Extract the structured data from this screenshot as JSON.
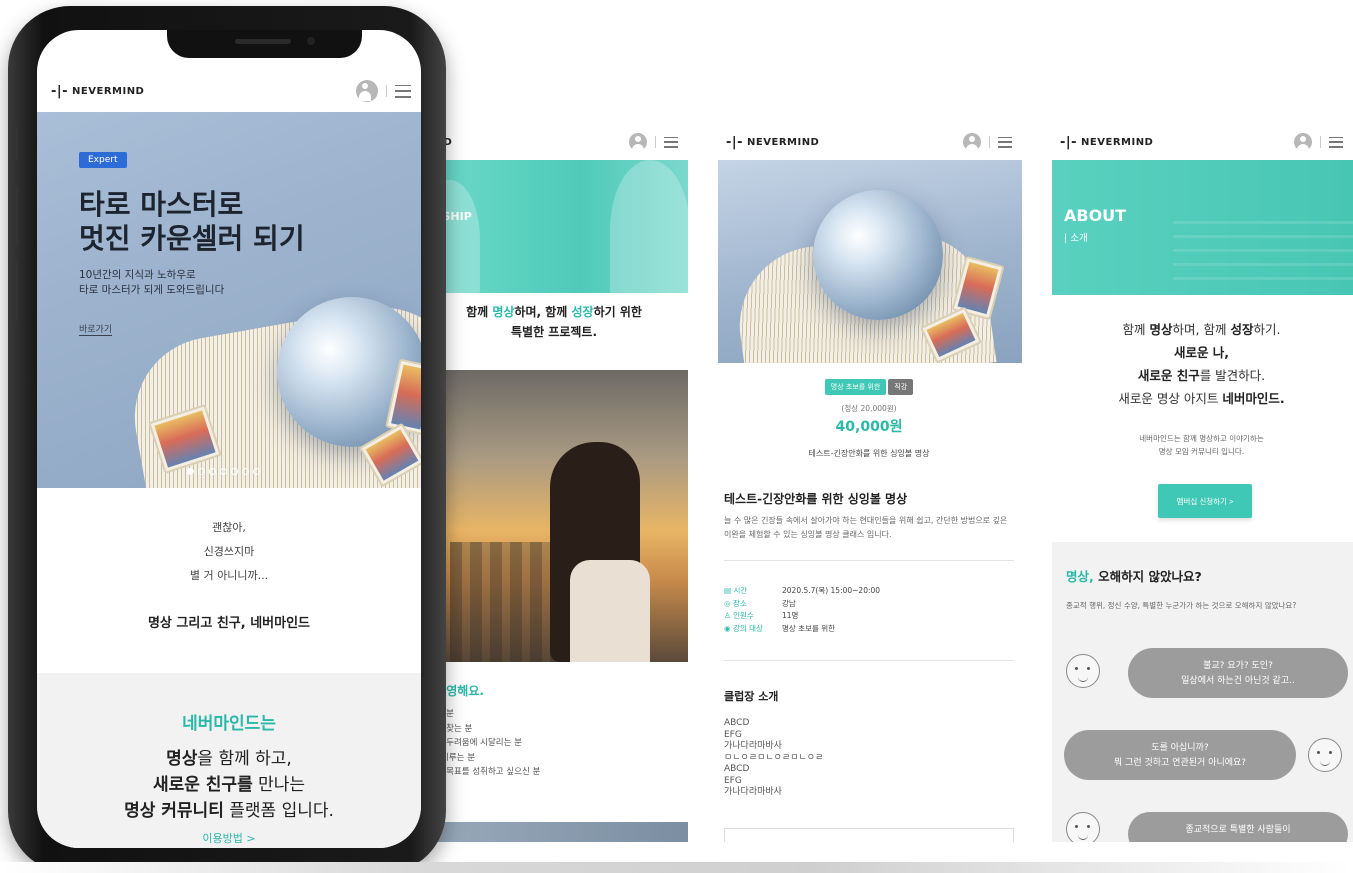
{
  "brand": {
    "logo_text": "NEVERMIND",
    "logo_mark": "-|-"
  },
  "phone": {
    "hero": {
      "badge": "Expert",
      "title_line1": "타로 마스터로",
      "title_line2": "멋진 카운셀러 되기",
      "subtitle_line1": "10년간의 지식과 노하우로",
      "subtitle_line2": "타로 마스터가 되게 도와드립니다",
      "link": "바로가기",
      "slide_count": 7,
      "active_slide": 1
    },
    "quote": {
      "line1": "괜찮아,",
      "line2": "신경쓰지마",
      "line3": "별 거 아니니까...",
      "tagline": "명상 그리고 친구, 네버마인드"
    },
    "intro": {
      "title": "네버마인드는",
      "line1_bold": "명상",
      "line1_rest": "을 함께 하고,",
      "line2_bold": "새로운 친구를",
      "line2_rest": " 만나는",
      "line3_bold": "명상 커뮤니티",
      "line3_rest": " 플랫폼 입니다.",
      "more_link": "이용방법 >"
    }
  },
  "screen2": {
    "logo_partial": "M|ND",
    "banner_label": "RSHIP",
    "tagline_pre": "함께 ",
    "tagline_hl1": "명상",
    "tagline_mid": "하며, 함께 ",
    "tagline_hl2": "성장",
    "tagline_post": "하기 위한",
    "tagline_line2": "특별한 프로젝트.",
    "welcome": "을 환영해요.",
    "list": [
      "지치신 분",
      "의미를 찾는 분",
      "안감과 두려움에 시달리는 분",
      "을 못 이루는 분",
      "인생의 목표를 성취하고 싶으신 분"
    ]
  },
  "screen3": {
    "chips": [
      "명상 초보를 위한",
      "직강"
    ],
    "orig_price": "(정상 20,000원)",
    "price": "40,000원",
    "subtitle": "테스트-긴장안화를 위한 싱잉볼 명상",
    "title": "테스트-긴장안화를 위한 싱잉볼 명상",
    "desc": "늘 수 많은 긴장들 속에서 살아가야 하는 현대인들을 위해 쉽고, 간단한 방법으로 깊은 이완을 체험할 수 있는 싱잉볼 명상 클래스 입니다.",
    "info": [
      {
        "key": "시간",
        "value": "2020.5.7(목) 15:00~20:00"
      },
      {
        "key": "장소",
        "value": "강남"
      },
      {
        "key": "인원수",
        "value": "11명"
      },
      {
        "key": "강의 대상",
        "value": "명상 초보를 위한"
      }
    ],
    "club_title": "클럽장 소개",
    "club_lines": [
      "ABCD",
      "EFG",
      "가나다라마바사",
      "ㅁㄴㅇㄹㅁㄴㅇㄹㅁㄴㅇㄹ",
      "ABCD",
      "EFG",
      "가나다라마바사"
    ]
  },
  "screen4": {
    "banner_title": "ABOUT",
    "banner_sub": "| 소개",
    "intro_l1_a": "함께 ",
    "intro_l1_b": "명상",
    "intro_l1_c": "하며, 함께 ",
    "intro_l1_d": "성장",
    "intro_l1_e": "하기.",
    "intro_l2": "새로운 나,",
    "intro_l3_bold": "새로운 친구",
    "intro_l3_rest": "를 발견하다.",
    "intro_l4_pre": "새로운 명상 아지트 ",
    "intro_l4_hl": "네버마인드.",
    "small_l1": "네버마인드는 함께 명상하고 이야기하는",
    "small_l2": "명상 모임 커뮤니티 입니다.",
    "button": "멤버십 신청하기 >",
    "section_hl": "명상,",
    "section_title": " 오해하지 않았나요?",
    "section_desc": "종교적 행위, 정신 수양, 특별한 누군가가 하는 것으로 오해하지 않았나요?",
    "bubble1_l1": "불교? 요가? 도인?",
    "bubble1_l2": "일상에서 하는건 아닌것 같고..",
    "bubble2_l1": "도를 아십니까?",
    "bubble2_l2": "뭐 그런 것하고 연관된거 아니에요?",
    "bubble3_l1": "종교적으로 특별한 사람들이"
  },
  "colors": {
    "accent": "#3fc8b5",
    "accent_text": "#2ab8a8",
    "badge_blue": "#2d6bd6",
    "bubble_grey": "#9c9c9c"
  }
}
